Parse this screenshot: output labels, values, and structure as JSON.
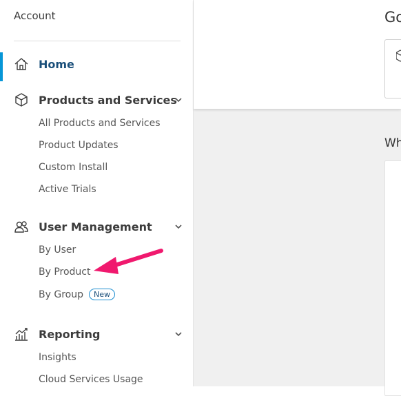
{
  "sidebar": {
    "title": "Account",
    "home_label": "Home",
    "products": {
      "label": "Products and Services",
      "items": [
        "All Products and Services",
        "Product Updates",
        "Custom Install",
        "Active Trials"
      ]
    },
    "users": {
      "label": "User Management",
      "items": [
        "By User",
        "By Product",
        "By Group"
      ],
      "group_badge": "New"
    },
    "reporting": {
      "label": "Reporting",
      "items": [
        "Insights",
        "Cloud Services Usage"
      ]
    }
  },
  "main": {
    "heading_partial": "Go",
    "section_partial": "Wh"
  },
  "colors": {
    "accent": "#0696d7",
    "active_label": "#1a4f7a",
    "annotation_arrow": "#f0196e",
    "content_background": "#f0f0f0"
  }
}
